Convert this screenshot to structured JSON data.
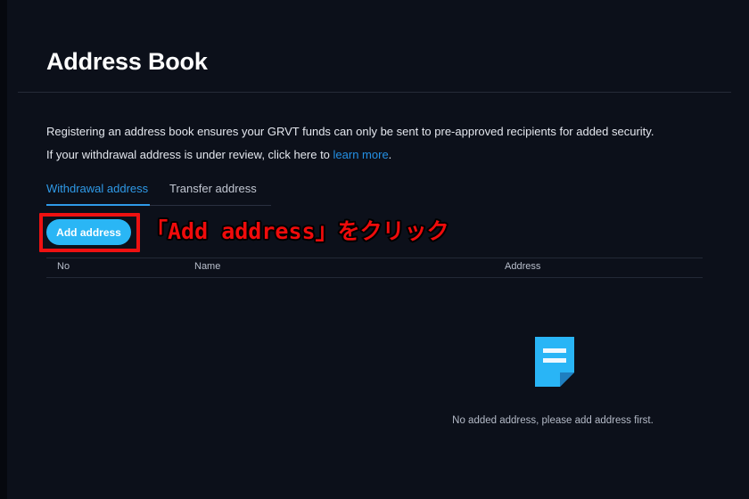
{
  "page": {
    "title": "Address Book",
    "background_color": "#0c101a"
  },
  "description": {
    "line1": "Registering an address book ensures your GRVT funds can only be sent to pre-approved recipients for added security.",
    "line2_prefix": "If your withdrawal address is under review, click here to ",
    "line2_link": "learn more",
    "line2_suffix": ".",
    "link_color": "#2490e4"
  },
  "tabs": {
    "items": [
      {
        "label": "Withdrawal address",
        "active": true
      },
      {
        "label": "Transfer address",
        "active": false
      }
    ],
    "active_color": "#2f9ae8"
  },
  "toolbar": {
    "add_address_label": "Add address",
    "add_address_color": "#2ab6f5"
  },
  "annotation": {
    "text": "「Add address」をクリック",
    "color": "#f00b0b",
    "box_color": "#ee1111"
  },
  "table": {
    "columns": [
      "No",
      "Name",
      "Address"
    ],
    "rows": []
  },
  "empty_state": {
    "icon": "document-icon",
    "icon_color": "#29b5f6",
    "message": "No added address, please add address first."
  }
}
